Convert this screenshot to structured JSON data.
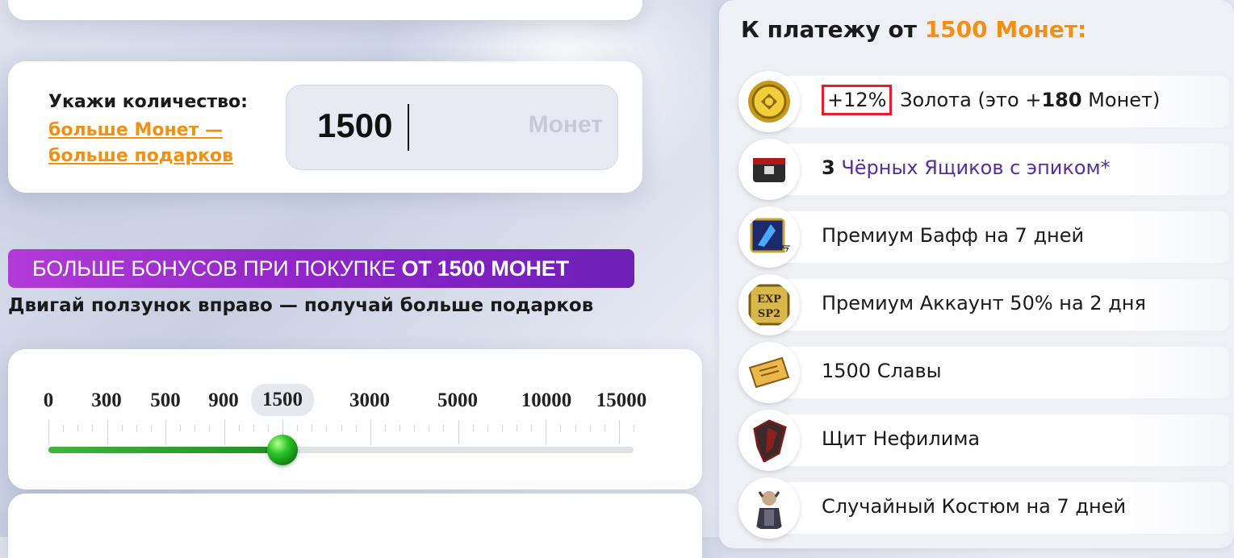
{
  "quantity": {
    "label": "Укажи количество:",
    "link_line1": "больше Монет —",
    "link_line2": "больше подарков",
    "value": "1500",
    "unit": "Монет"
  },
  "promo": {
    "banner_prefix": "БОЛЬШЕ БОНУСОВ ПРИ ПОКУПКЕ ",
    "banner_bold": "ОТ 1500 МОНЕТ",
    "hint": "Двигай ползунок вправо — получай больше подарков"
  },
  "slider": {
    "stops": [
      "0",
      "300",
      "500",
      "900",
      "1500",
      "3000",
      "5000",
      "10000",
      "15000"
    ],
    "selected_index": 4,
    "selected_fraction": 0.4
  },
  "bonus_panel": {
    "title_prefix": "К платежу от ",
    "title_accent": "1500 Монет:",
    "accent_color": "#f39012",
    "items": [
      {
        "icon": "gold-coin-icon",
        "pct": "+12%",
        "text_a": " Золота (это +",
        "text_b": "180",
        "text_c": " Монет)"
      },
      {
        "icon": "black-box-icon",
        "count": "3",
        "text": " Чёрных Ящиков с эпиком*"
      },
      {
        "icon": "premium-buff-icon",
        "text": "Премиум Бафф на 7 дней"
      },
      {
        "icon": "exp-sp-icon",
        "text": "Премиум Аккаунт 50% на 2 дня"
      },
      {
        "icon": "glory-ticket-icon",
        "text": "1500 Славы"
      },
      {
        "icon": "nephilim-shield-icon",
        "text": "Щит Нефилима"
      },
      {
        "icon": "costume-icon",
        "text": "Случайный Костюм на 7 дней"
      }
    ]
  }
}
